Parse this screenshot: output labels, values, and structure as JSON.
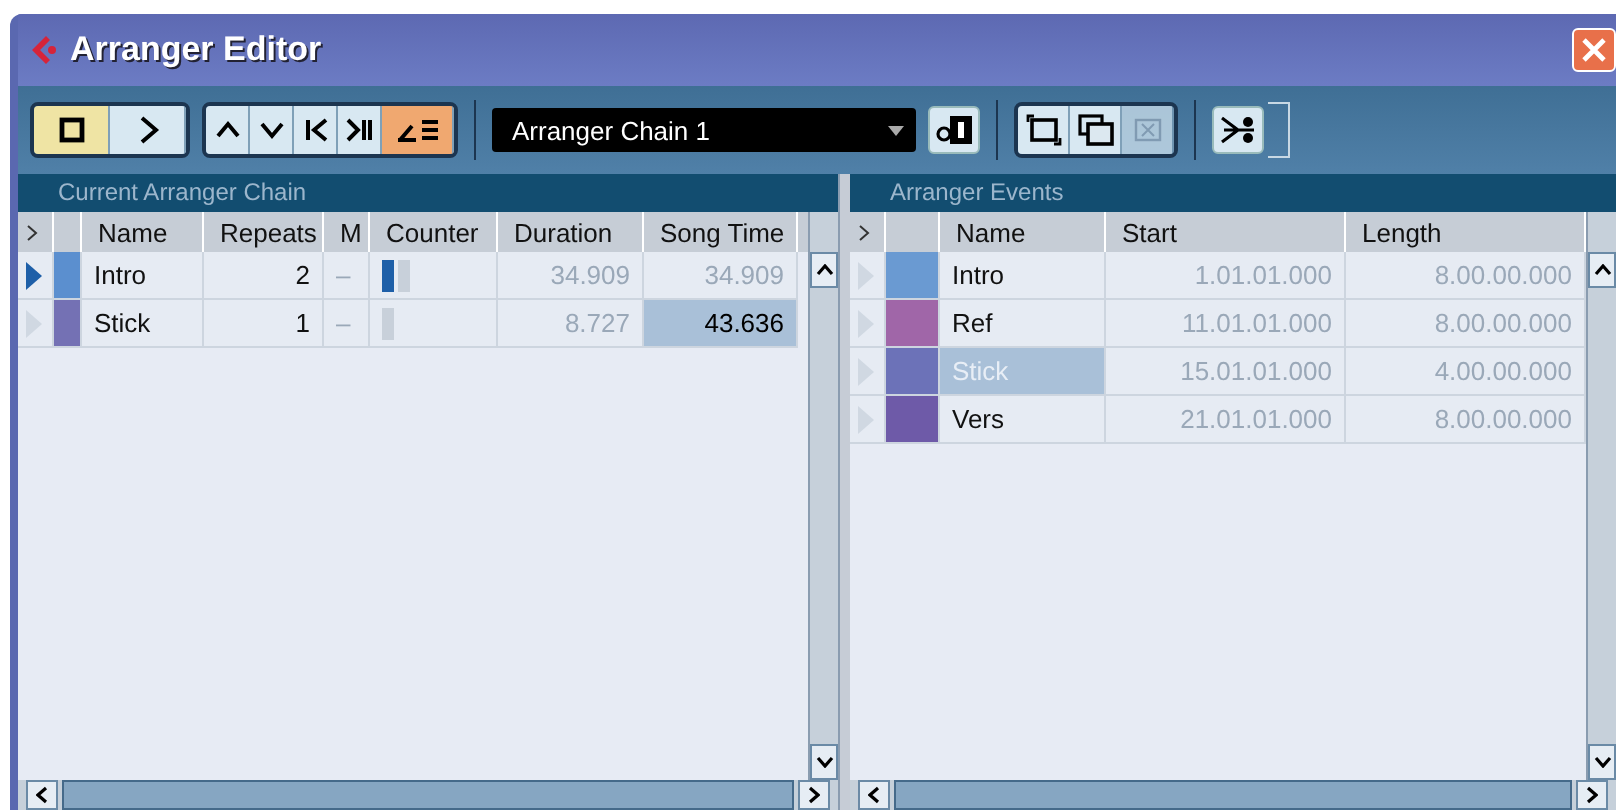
{
  "window": {
    "title": "Arranger Editor"
  },
  "toolbar": {
    "transport": [
      {
        "kind": "stop",
        "selected": true
      },
      {
        "kind": "play",
        "selected": false
      }
    ],
    "navigation": [
      {
        "kind": "previous",
        "selected": false
      },
      {
        "kind": "next",
        "selected": false
      },
      {
        "kind": "first",
        "selected": false
      },
      {
        "kind": "last",
        "selected": false
      },
      {
        "kind": "live",
        "selected": true
      }
    ],
    "chain_select": {
      "value": "Arranger Chain 1"
    }
  },
  "chain": {
    "title": "Current Arranger Chain",
    "columns": [
      "Name",
      "Repeats",
      "M",
      "Counter",
      "Duration",
      "Song Time"
    ],
    "rows": [
      {
        "playing": true,
        "color": "#5b8fcf",
        "name": "Intro",
        "repeats": "2",
        "mute": "–",
        "counting": true,
        "duration": "34.909",
        "song_time": "34.909",
        "selected": false
      },
      {
        "playing": false,
        "color": "#7471b4",
        "name": "Stick",
        "repeats": "1",
        "mute": "–",
        "counting": false,
        "duration": "8.727",
        "song_time": "43.636",
        "selected": true
      }
    ]
  },
  "events": {
    "title": "Arranger Events",
    "columns": [
      "Name",
      "Start",
      "Length"
    ],
    "rows": [
      {
        "color": "#6a9ad2",
        "name": "Intro",
        "start": "1.01.01.000",
        "length": "8.00.00.000",
        "selected": false
      },
      {
        "color": "#a066a8",
        "name": "Ref",
        "start": "11.01.01.000",
        "length": "8.00.00.000",
        "selected": false
      },
      {
        "color": "#6c72b8",
        "name": "Stick",
        "start": "15.01.01.000",
        "length": "4.00.00.000",
        "selected": true
      },
      {
        "color": "#6e5aa8",
        "name": "Vers",
        "start": "21.01.01.000",
        "length": "8.00.00.000",
        "selected": false
      }
    ]
  }
}
